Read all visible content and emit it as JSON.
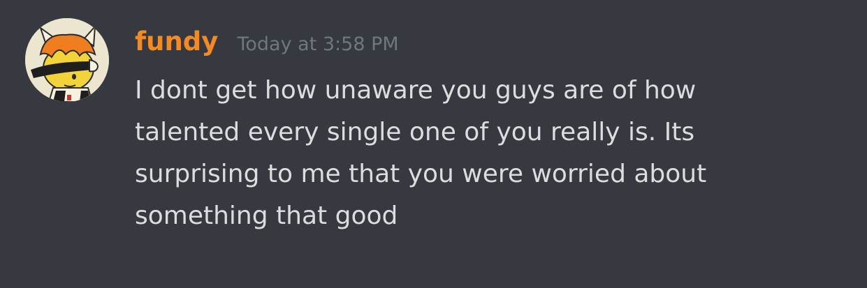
{
  "colors": {
    "background": "#36393f",
    "username": "#f48a21",
    "timestamp": "#72767d",
    "text": "#dcddde"
  },
  "message": {
    "avatar_icon": "user-avatar-icon",
    "author": "fundy",
    "timestamp": "Today at 3:58 PM",
    "lines": [
      "I dont get how unaware you guys are of how",
      "talented every single one of you really is. Its",
      "surprising to me that you were worried about",
      "something that good"
    ]
  }
}
